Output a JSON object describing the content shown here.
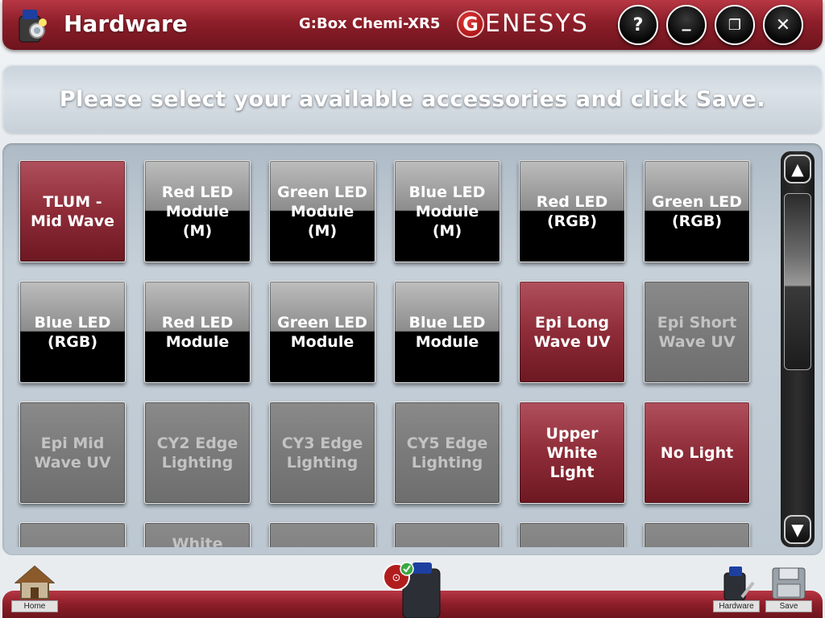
{
  "header": {
    "title": "Hardware",
    "device_name": "G:Box Chemi-XR5",
    "brand_initial": "G",
    "brand_rest": "ENESYS",
    "help_label": "?",
    "minimize_label": "_",
    "restore_label": "❐",
    "close_label": "✕"
  },
  "banner": {
    "text": "Please select your available accessories and click Save."
  },
  "accessories": [
    {
      "label": "TLUM - Mid Wave",
      "state": "selected"
    },
    {
      "label": "Red LED Module (M)",
      "state": "available"
    },
    {
      "label": "Green LED Module (M)",
      "state": "available"
    },
    {
      "label": "Blue LED Module (M)",
      "state": "available"
    },
    {
      "label": "Red LED (RGB)",
      "state": "available"
    },
    {
      "label": "Green LED (RGB)",
      "state": "available"
    },
    {
      "label": "Blue LED (RGB)",
      "state": "available"
    },
    {
      "label": "Red LED Module",
      "state": "available"
    },
    {
      "label": "Green LED Module",
      "state": "available"
    },
    {
      "label": "Blue LED Module",
      "state": "available"
    },
    {
      "label": "Epi Long Wave UV",
      "state": "selected"
    },
    {
      "label": "Epi Short Wave UV",
      "state": "disabled"
    },
    {
      "label": "Epi Mid Wave UV",
      "state": "disabled"
    },
    {
      "label": "CY2 Edge Lighting",
      "state": "disabled"
    },
    {
      "label": "CY3 Edge Lighting",
      "state": "disabled"
    },
    {
      "label": "CY5 Edge Lighting",
      "state": "disabled"
    },
    {
      "label": "Upper White Light",
      "state": "selected"
    },
    {
      "label": "No Light",
      "state": "selected"
    },
    {
      "label": "",
      "state": "disabled"
    },
    {
      "label": "White",
      "state": "disabled"
    },
    {
      "label": "",
      "state": "disabled"
    },
    {
      "label": "",
      "state": "disabled"
    },
    {
      "label": "",
      "state": "disabled"
    },
    {
      "label": "",
      "state": "disabled"
    }
  ],
  "scroll": {
    "up_label": "▲",
    "down_label": "▼"
  },
  "footer": {
    "home_label": "Home",
    "hardware_label": "Hardware",
    "save_label": "Save"
  },
  "colors": {
    "brand_red": "#8c1e29",
    "tile_selected": "#8e2c38",
    "tile_available": "#000000",
    "tile_disabled": "#7a7a7a"
  }
}
